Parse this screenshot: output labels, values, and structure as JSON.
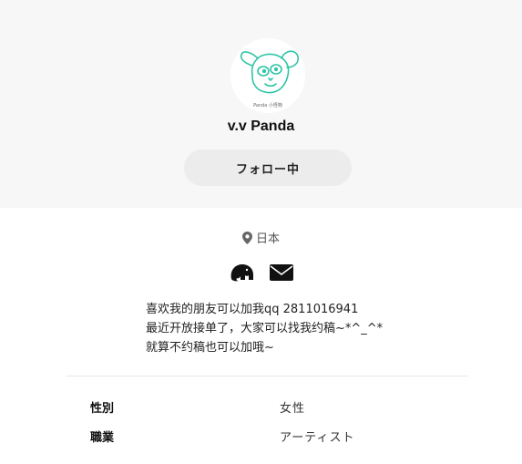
{
  "profile": {
    "avatar_caption": "Panda 小怪物",
    "name": "v.v Panda",
    "follow_label": "フォロー中"
  },
  "location": {
    "icon": "map-pin-icon",
    "text": "日本"
  },
  "social": {
    "icons": [
      "elephant-icon",
      "mail-icon"
    ]
  },
  "bio": {
    "lines": [
      "喜欢我的朋友可以加我qq 2811016941",
      "最近开放接单了，大家可以找我约稿~*^_^*",
      "就算不约稿也可以加哦~"
    ]
  },
  "details": [
    {
      "label": "性別",
      "value": "女性"
    },
    {
      "label": "職業",
      "value": "アーティスト"
    }
  ],
  "colors": {
    "header_bg": "#f7f7f7",
    "button_bg": "#ececec",
    "avatar_stroke": "#2ec4a6"
  }
}
